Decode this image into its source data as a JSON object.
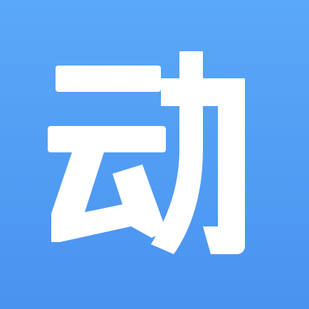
{
  "icon": {
    "glyph": "动",
    "colors": {
      "background_top": "#5aa8f9",
      "background_bottom": "#4a93ef",
      "glyph": "#ffffff"
    }
  }
}
